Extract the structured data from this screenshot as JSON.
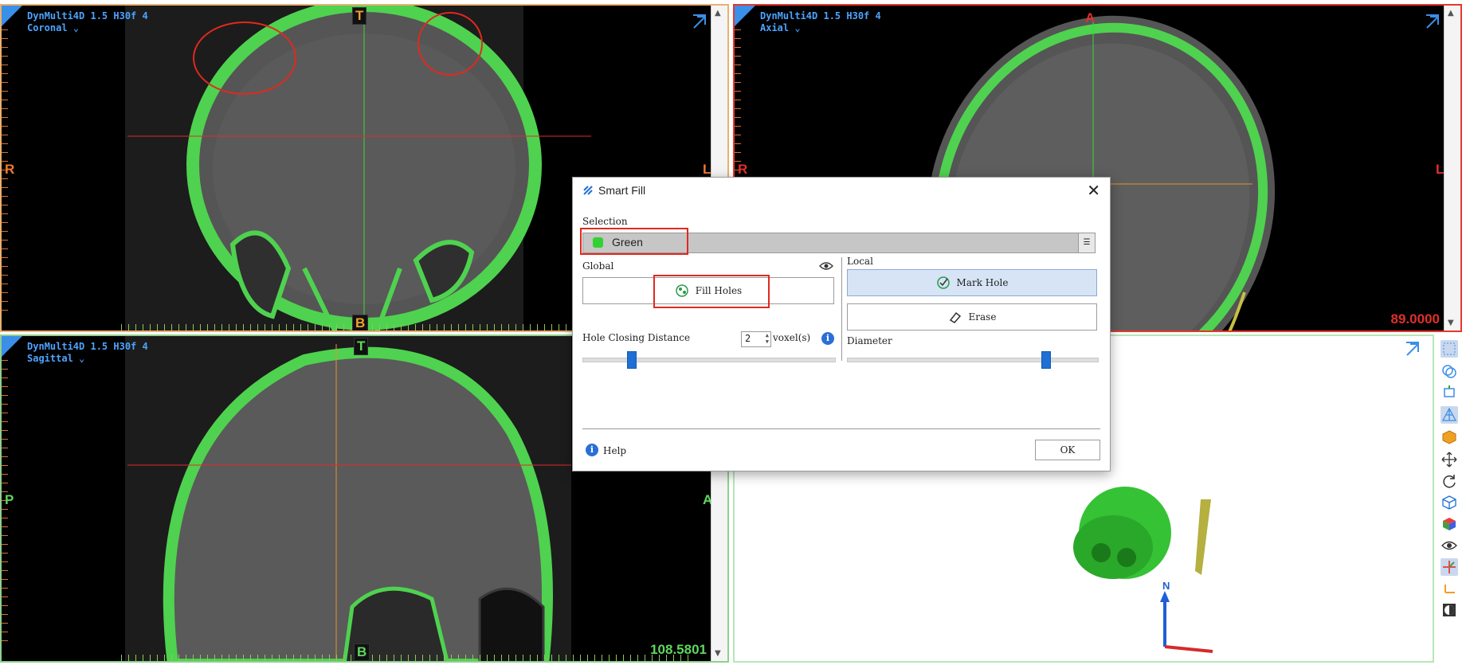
{
  "viewports": {
    "coronal": {
      "line1": "DynMulti4D  1.5  H30f 4",
      "view": "Coronal",
      "top": "T",
      "bottom": "B",
      "left": "R",
      "right": "L"
    },
    "axial": {
      "line1": "DynMulti4D  1.5  H30f 4",
      "view": "Axial",
      "top": "A",
      "left": "R",
      "right": "L",
      "value": "89.0000"
    },
    "sagittal": {
      "line1": "DynMulti4D  1.5  H30f 4",
      "view": "Sagittal",
      "top": "T",
      "bottom": "B",
      "left": "P",
      "right": "A",
      "value": "108.5801"
    },
    "three_d": {
      "axis_label": "N"
    }
  },
  "dialog": {
    "title": "Smart Fill",
    "selection_label": "Selection",
    "selection_value": "Green",
    "global_label": "Global",
    "local_label": "Local",
    "fill_holes": "Fill Holes",
    "mark_hole": "Mark Hole",
    "erase": "Erase",
    "hole_distance_label": "Hole Closing Distance",
    "hole_distance_value": "2",
    "hole_distance_unit": "voxel(s)",
    "diameter_label": "Diameter",
    "help": "Help",
    "ok": "OK",
    "hole_slider_level": 0.18,
    "diameter_slider_level": 0.8
  },
  "colors": {
    "accent": "#1f6fd4",
    "segment_green": "#34d134",
    "annotation_red": "#e0291f",
    "viewport_info_blue": "#4da3ff"
  },
  "toolbar_icons": [
    "grid-icon",
    "overlay-icon",
    "crop-icon",
    "mesh-icon",
    "cube-color-icon",
    "move-icon",
    "rotate-icon",
    "box-icon",
    "color-cube-icon",
    "eye-icon",
    "axes-icon",
    "axes-small-icon",
    "contrast-icon"
  ]
}
